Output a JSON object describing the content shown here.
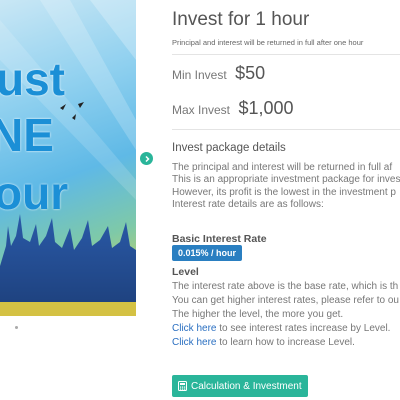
{
  "banner": {
    "line1": "ust",
    "line2": "NE",
    "line3": "our"
  },
  "title": "Invest for 1 hour",
  "subtitle": "Principal and interest will be returned in full after one hour",
  "min_invest": {
    "label": "Min Invest",
    "value": "$50"
  },
  "max_invest": {
    "label": "Max Invest",
    "value": "$1,000"
  },
  "details": {
    "title": "Invest package details",
    "lines": [
      "The principal and interest will be returned in full af",
      "This is an appropriate investment package for inves",
      "However, its profit is the lowest in the investment p",
      "Interest rate details are as follows:"
    ]
  },
  "basic_rate": {
    "label": "Basic Interest Rate",
    "value": "0.015% / hour"
  },
  "level": {
    "label": "Level",
    "line1": "The interest rate above is the base rate, which is th",
    "line2": "You can get higher interest rates, please refer to ou",
    "line3": "The higher the level, the more you get.",
    "link1": "Click here",
    "link1_rest": " to see interest rates increase by Level.",
    "link2": "Click here",
    "link2_rest": " to learn how to increase Level."
  },
  "calc_button": "Calculation & Investment",
  "colors": {
    "accent": "#2ab59a",
    "badge": "#2a7fc1",
    "link": "#2a6fc1"
  },
  "icons": {
    "next": "chevron-right-icon",
    "calc": "calculator-icon"
  }
}
